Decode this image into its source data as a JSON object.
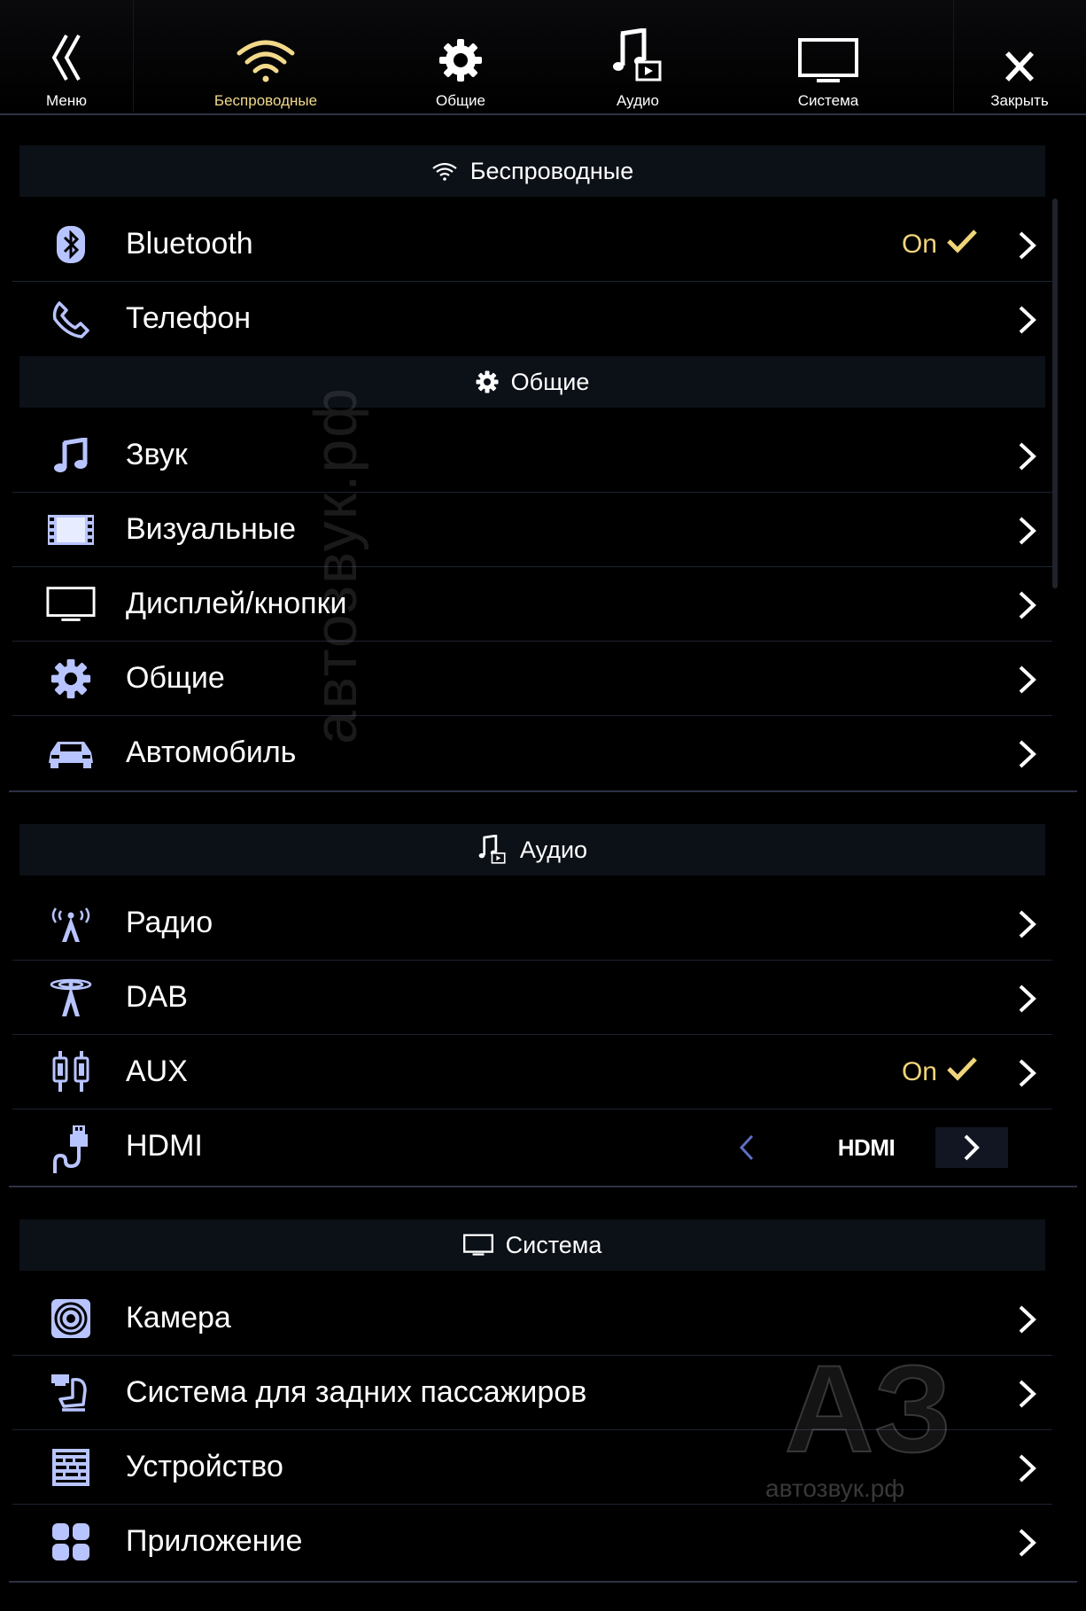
{
  "topbar": {
    "menu_label": "Меню",
    "wireless_label": "Беспроводные",
    "general_label": "Общие",
    "audio_label": "Аудио",
    "system_label": "Система",
    "close_label": "Закрыть"
  },
  "sections": {
    "wireless": {
      "title": "Беспроводные",
      "items": [
        {
          "label": "Bluetooth",
          "status": "On",
          "icon": "bluetooth-icon"
        },
        {
          "label": "Телефон",
          "icon": "phone-icon"
        }
      ]
    },
    "general": {
      "title": "Общие",
      "items": [
        {
          "label": "Звук",
          "icon": "music-note-icon"
        },
        {
          "label": "Визуальные",
          "icon": "film-strip-icon"
        },
        {
          "label": "Дисплей/кнопки",
          "icon": "monitor-icon"
        },
        {
          "label": "Общие",
          "icon": "gear-icon"
        },
        {
          "label": "Автомобиль",
          "icon": "car-icon"
        }
      ]
    },
    "audio": {
      "title": "Аудио",
      "items": [
        {
          "label": "Радио",
          "icon": "radio-antenna-icon"
        },
        {
          "label": "DAB",
          "icon": "dab-antenna-icon"
        },
        {
          "label": "AUX",
          "status": "On",
          "icon": "rca-plug-icon"
        },
        {
          "label": "HDMI",
          "value": "HDMI",
          "icon": "hdmi-cable-icon"
        }
      ]
    },
    "system": {
      "title": "Система",
      "items": [
        {
          "label": "Камера",
          "icon": "camera-icon"
        },
        {
          "label": "Система для задних пассажиров",
          "icon": "rear-seat-icon"
        },
        {
          "label": "Устройство",
          "icon": "device-keyboard-icon"
        },
        {
          "label": "Приложение",
          "icon": "apps-grid-icon"
        }
      ]
    }
  },
  "watermark": {
    "vertical_text": "автозвук.рф",
    "logo_text": "автозвук.рф",
    "logo_letters": "АЗ"
  },
  "colors": {
    "accent": "#f0d47a",
    "icon_blue": "#b8c4ff",
    "header_bg": "#0c1017"
  }
}
